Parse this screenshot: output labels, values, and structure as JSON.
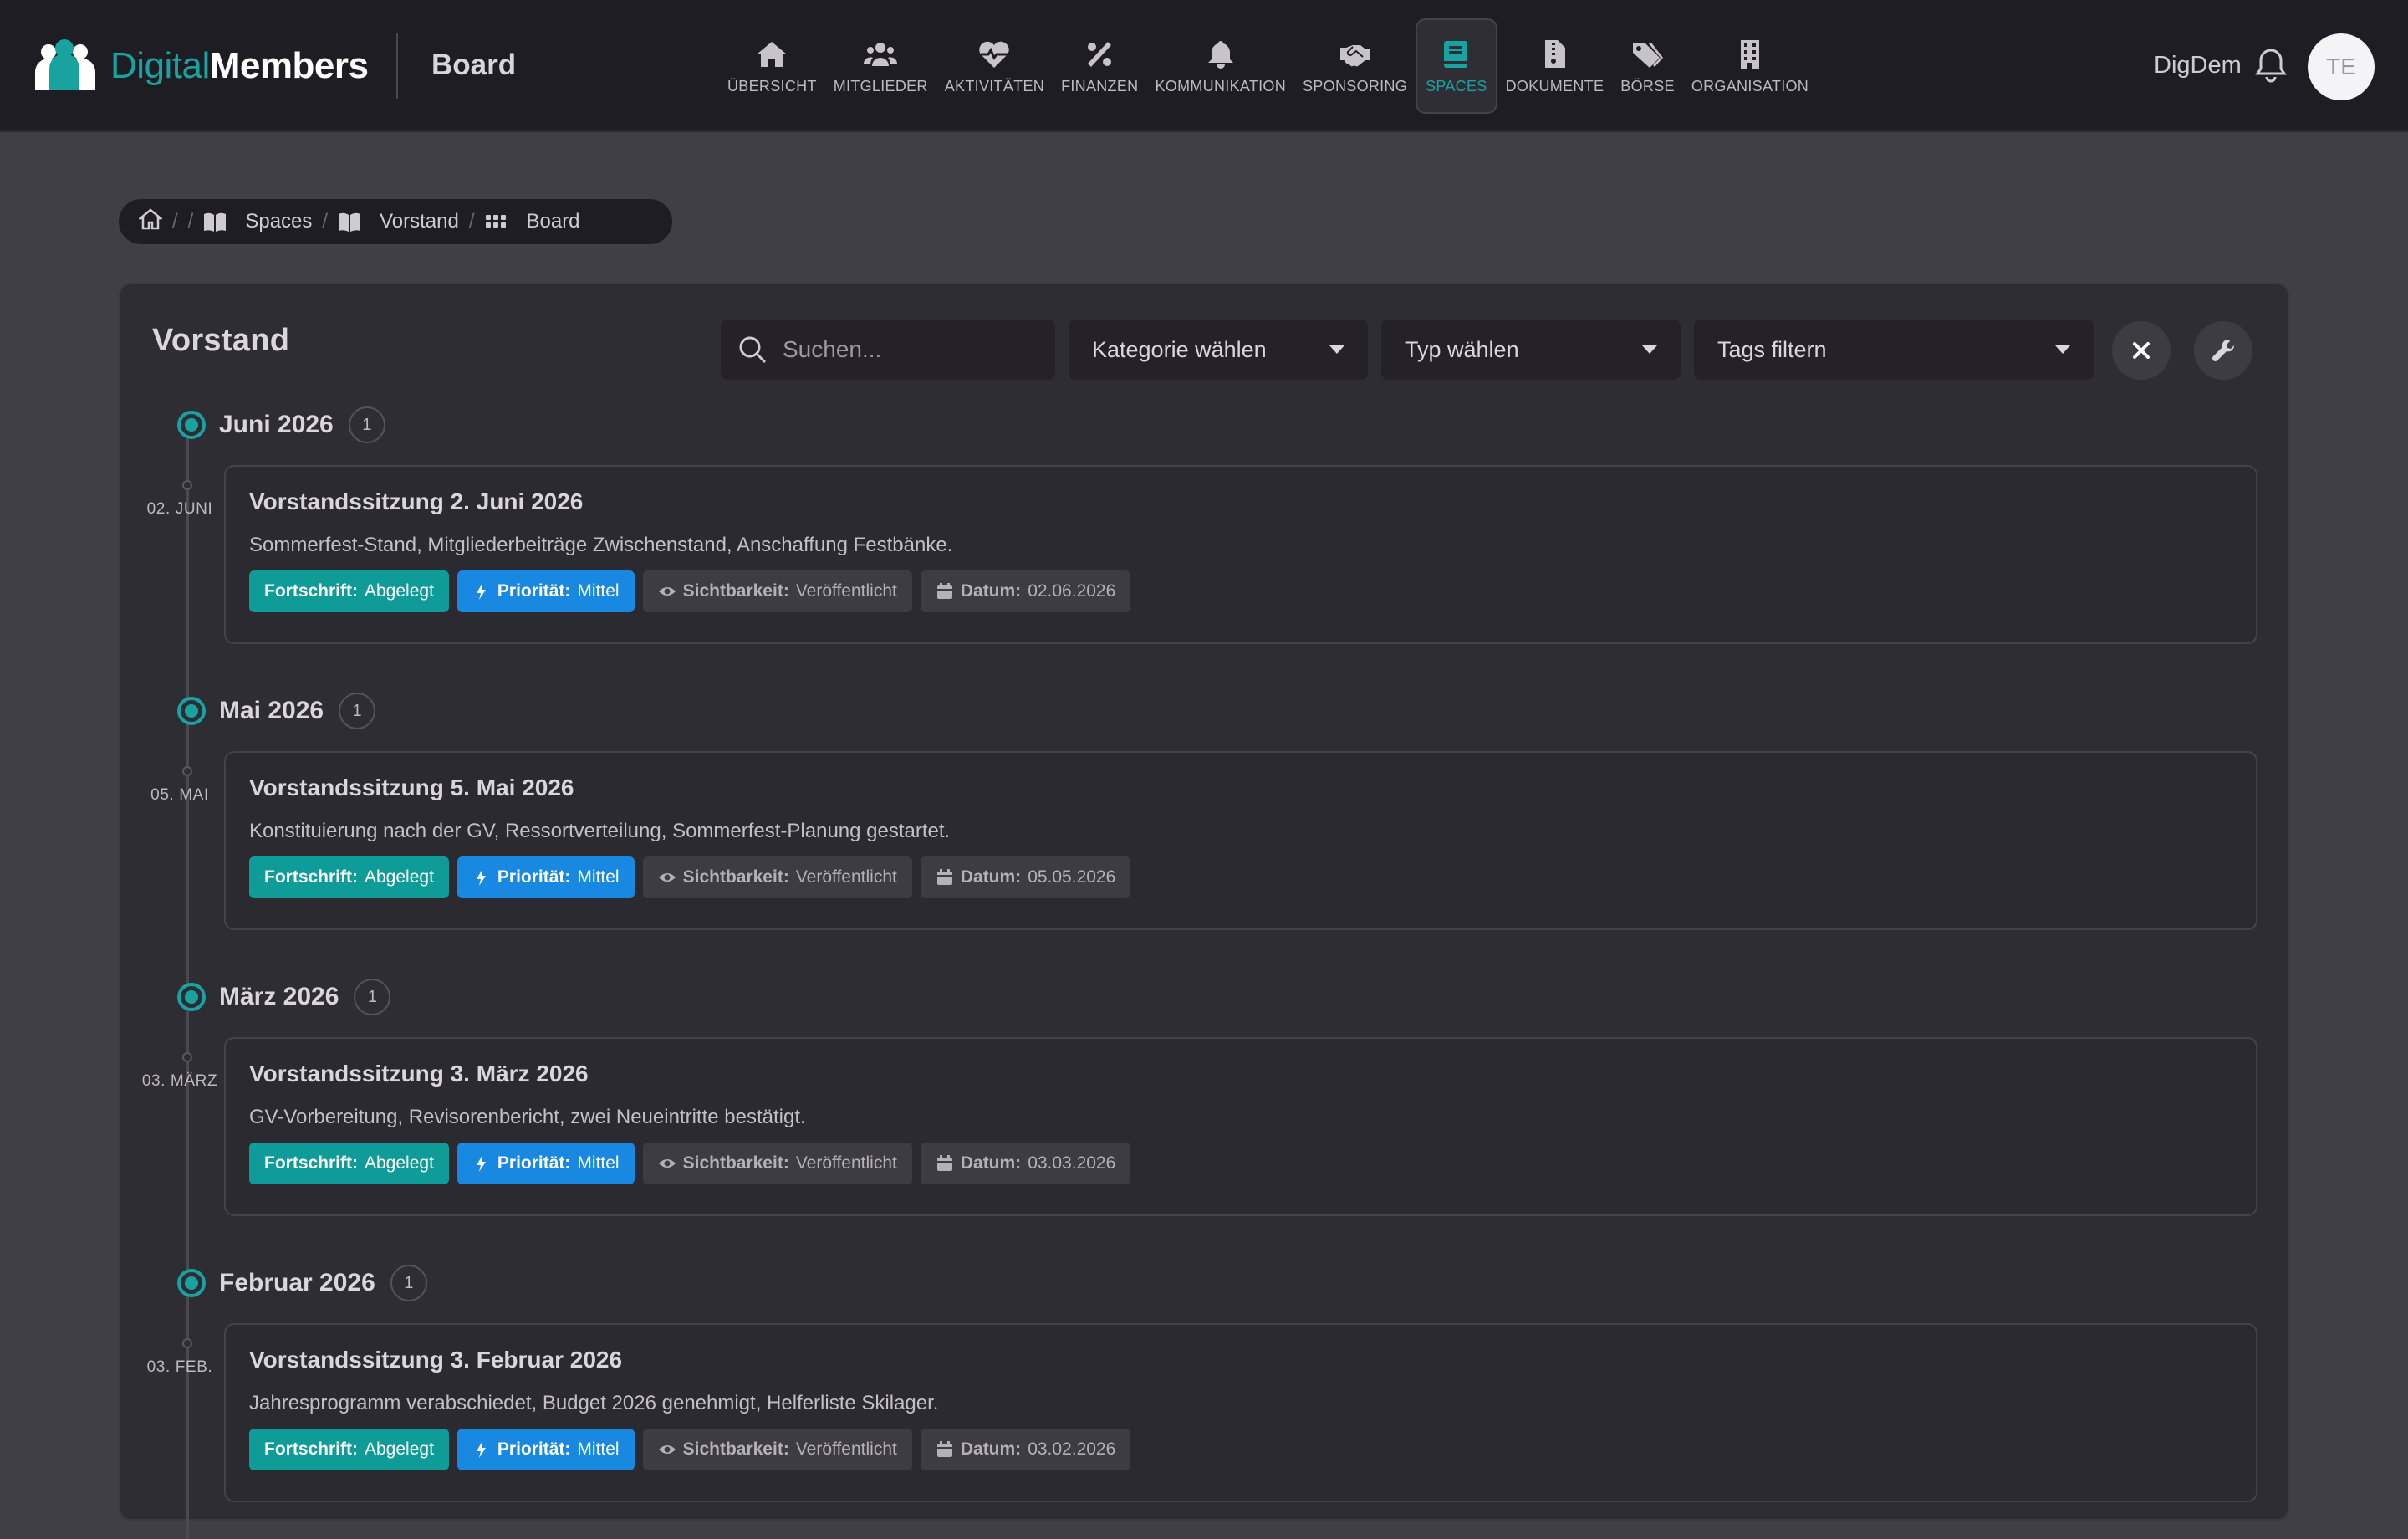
{
  "app": {
    "logo_part1": "Digital",
    "logo_part2": "Members",
    "section_title": "Board",
    "user_name": "DigDem",
    "avatar_initials": "TE"
  },
  "nav": [
    {
      "label": "ÜBERSICHT",
      "icon": "home-icon"
    },
    {
      "label": "MITGLIEDER",
      "icon": "users-icon"
    },
    {
      "label": "AKTIVITÄTEN",
      "icon": "heartbeat-icon"
    },
    {
      "label": "FINANZEN",
      "icon": "percent-icon"
    },
    {
      "label": "KOMMUNIKATION",
      "icon": "bell-icon"
    },
    {
      "label": "SPONSORING",
      "icon": "handshake-icon"
    },
    {
      "label": "SPACES",
      "icon": "book-icon",
      "active": true
    },
    {
      "label": "DOKUMENTE",
      "icon": "file-zip-icon"
    },
    {
      "label": "BÖRSE",
      "icon": "tags-icon"
    },
    {
      "label": "ORGANISATION",
      "icon": "building-icon"
    }
  ],
  "breadcrumb": {
    "items": [
      "Spaces",
      "Vorstand",
      "Board"
    ]
  },
  "panel": {
    "title": "Vorstand",
    "search_placeholder": "Suchen...",
    "category_select": "Kategorie wählen",
    "type_select": "Typ wählen",
    "tags_select": "Tags filtern"
  },
  "labels": {
    "progress": "Fortschrift:",
    "priority": "Priorität:",
    "visibility": "Sichtbarkeit:",
    "date": "Datum:"
  },
  "groups": [
    {
      "month": "Juni 2026",
      "count": "1",
      "day": "02. JUNI",
      "title": "Vorstandssitzung 2. Juni 2026",
      "description": "Sommerfest-Stand, Mitgliederbeiträge Zwischenstand, Anschaffung Festbänke.",
      "progress": "Abgelegt",
      "priority": "Mittel",
      "visibility": "Veröffentlicht",
      "date": "02.06.2026"
    },
    {
      "month": "Mai 2026",
      "count": "1",
      "day": "05. MAI",
      "title": "Vorstandssitzung 5. Mai 2026",
      "description": "Konstituierung nach der GV, Ressortverteilung, Sommerfest-Planung gestartet.",
      "progress": "Abgelegt",
      "priority": "Mittel",
      "visibility": "Veröffentlicht",
      "date": "05.05.2026"
    },
    {
      "month": "März 2026",
      "count": "1",
      "day": "03. MÄRZ",
      "title": "Vorstandssitzung 3. März 2026",
      "description": "GV-Vorbereitung, Revisorenbericht, zwei Neueintritte bestätigt.",
      "progress": "Abgelegt",
      "priority": "Mittel",
      "visibility": "Veröffentlicht",
      "date": "03.03.2026"
    },
    {
      "month": "Februar 2026",
      "count": "1",
      "day": "03. FEB.",
      "title": "Vorstandssitzung 3. Februar 2026",
      "description": "Jahresprogramm verabschiedet, Budget 2026 genehmigt, Helferliste Skilager.",
      "progress": "Abgelegt",
      "priority": "Mittel",
      "visibility": "Veröffentlicht",
      "date": "03.02.2026"
    }
  ],
  "colors": {
    "accent": "#19a3a0",
    "progress_badge": "#0f9b98",
    "priority_badge": "#1888e0",
    "header_bg": "#1f1d24",
    "page_bg": "#403e46"
  }
}
